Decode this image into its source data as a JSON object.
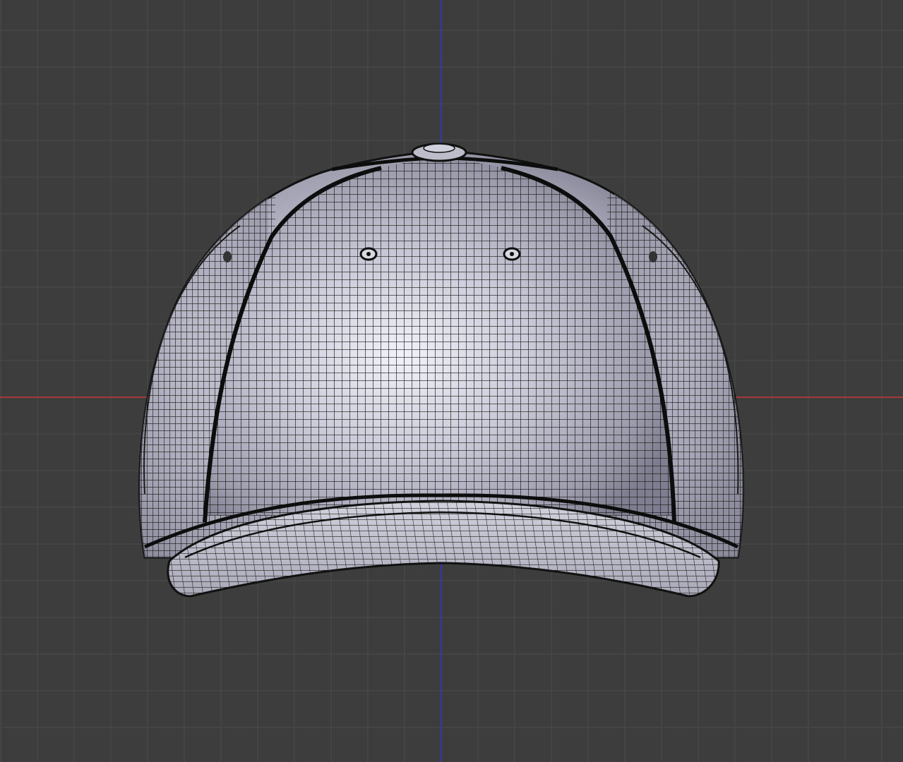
{
  "viewport": {
    "background": "#3d3d3d",
    "grid_color": "#4a4a4a",
    "x_axis_color": "#a33a3a",
    "z_axis_color": "#3636b0"
  },
  "model": {
    "object": "baseball-cap",
    "display": "wireframe-over-solid",
    "surface_color": "#c4c4d2",
    "wire_color": "#111111"
  }
}
